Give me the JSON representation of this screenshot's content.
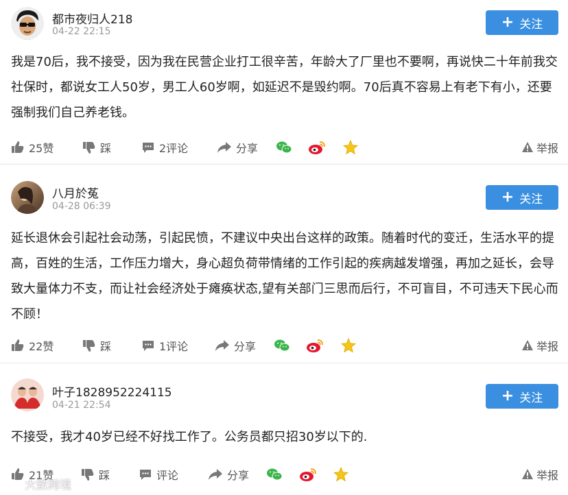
{
  "comments": [
    {
      "username": "都市夜归人218",
      "time": "04-22 22:15",
      "follow_label": "关注",
      "text": "我是70后，我不接受，因为我在民营企业打工很辛苦，年龄大了厂里也不要啊，再说快二十年前我交社保时，都说女工人50岁，男工人60岁啊，如延迟不是毁约啊。70后真不容易上有老下有小，还要强制我们自己养老钱。",
      "likes_label": "25赞",
      "dislike_label": "踩",
      "comments_label": "2评论",
      "share_label": "分享",
      "report_label": "举报",
      "avatar_icon": "cartoon-man-sunglasses-avatar"
    },
    {
      "username": "八月於菟",
      "time": "04-28 06:39",
      "follow_label": "关注",
      "text": "延长退休会引起社会动荡，引起民愤，不建议中央出台这样的政策。随着时代的变迁，生活水平的提高，百姓的生活，工作压力增大，身心超负荷带情绪的工作引起的疾病越发增强，再加之延长，会导致大量体力不支，而让社会经济处于瘫痪状态,望有关部门三思而后行，不可盲目，不可违天下民心而不顾！",
      "likes_label": "22赞",
      "dislike_label": "踩",
      "comments_label": "1评论",
      "share_label": "分享",
      "report_label": "举报",
      "avatar_icon": "photo-person-avatar"
    },
    {
      "username": "叶子1828952224115",
      "time": "04-21 22:54",
      "follow_label": "关注",
      "text": "不接受，我才40岁已经不好找工作了。公务员都只招30岁以下的.",
      "likes_label": "21赞",
      "dislike_label": "踩",
      "comments_label": "评论",
      "share_label": "分享",
      "report_label": "举报",
      "avatar_icon": "photo-group-avatar"
    }
  ],
  "watermark": "大數跨境",
  "colors": {
    "accent": "#3a8fe0",
    "wechat": "#3bb54a",
    "weibo": "#e6162d",
    "favorite": "#f5c518",
    "muted": "#999999"
  }
}
